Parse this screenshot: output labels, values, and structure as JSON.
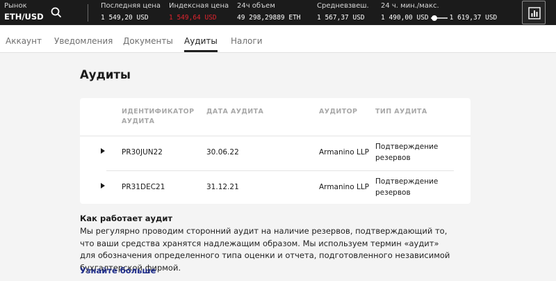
{
  "market": {
    "label": "Рынок",
    "pair": "ETH/USD"
  },
  "icons": {
    "search": "search-icon",
    "chart": "bar-chart-icon"
  },
  "stats": {
    "last_price": {
      "label": "Последняя цена",
      "value": "1 549,20 USD"
    },
    "index_price": {
      "label": "Индексная цена",
      "value": "1 549,64 USD"
    },
    "volume_24h": {
      "label": "24ч объем",
      "value": "49 298,29889 ETH"
    },
    "vwap": {
      "label": "Средневзвеш.",
      "value": "1 567,37 USD"
    },
    "range_24h": {
      "label": "24 ч. мин./макс.",
      "min": "1 490,00 USD",
      "max": "1 619,37 USD",
      "position": 0.1
    }
  },
  "colors": {
    "topbar_bg": "#1b1b1b",
    "negative": "#e0242e",
    "link": "#1f2d8a"
  },
  "tabs": [
    {
      "label": "Аккаунт",
      "active": false
    },
    {
      "label": "Уведомления",
      "active": false
    },
    {
      "label": "Документы",
      "active": false
    },
    {
      "label": "Аудиты",
      "active": true
    },
    {
      "label": "Налоги",
      "active": false
    }
  ],
  "main": {
    "title": "Аудиты",
    "table": {
      "headers": [
        "Идентификатор аудита",
        "Дата аудита",
        "Аудитор",
        "Тип аудита"
      ],
      "rows": [
        {
          "id": "PR30JUN22",
          "date": "30.06.22",
          "auditor": "Armanino LLP",
          "type": "Подтверждение резервов"
        },
        {
          "id": "PR31DEC21",
          "date": "31.12.21",
          "auditor": "Armanino LLP",
          "type": "Подтверждение резервов"
        }
      ]
    },
    "how": {
      "title": "Как работает аудит",
      "text": "Мы регулярно проводим сторонний аудит на наличие резервов, подтверждающий то, что ваши средства хранятся надлежащим образом. Мы используем термин «аудит» для обозначения определенного типа оценки и отчета, подготовленного независимой бухгалтерской фирмой.",
      "link": "Узнайте больше"
    }
  }
}
